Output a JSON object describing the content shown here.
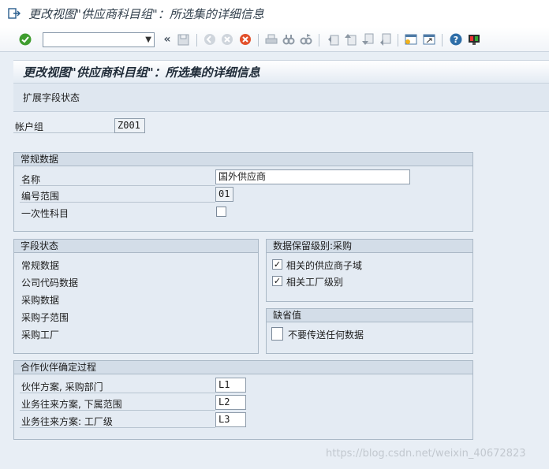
{
  "window": {
    "title": "更改视图\"供应商科目组\"：所选集的详细信息"
  },
  "toolbar": {
    "command_value": "",
    "icons": [
      "check-icon",
      "dropdown-icon",
      "back-double-icon",
      "save-icon",
      "back-icon",
      "exit-icon",
      "cancel-icon",
      "print-icon",
      "find-icon",
      "find-next-icon",
      "first-page-icon",
      "prev-page-icon",
      "next-page-icon",
      "last-page-icon",
      "new-session-icon",
      "shortcut-icon",
      "help-icon",
      "customize-icon"
    ]
  },
  "header": {
    "title": "更改视图\"供应商科目组\"：所选集的详细信息"
  },
  "subbar": {
    "expand_label": "扩展字段状态"
  },
  "account_group": {
    "label": "帐户组",
    "value": "Z001"
  },
  "general": {
    "title": "常规数据",
    "name_label": "名称",
    "name_value": "国外供应商",
    "range_label": "编号范围",
    "range_value": "01",
    "onetime_label": "一次性科目"
  },
  "field_status": {
    "title": "字段状态",
    "items": [
      "常规数据",
      "公司代码数据",
      "采购数据",
      "采购子范围",
      "采购工厂"
    ]
  },
  "retention": {
    "title": "数据保留级别:采购",
    "items": [
      {
        "label": "相关的供应商子域",
        "checked": true
      },
      {
        "label": "相关工厂级别",
        "checked": true
      }
    ]
  },
  "defaults": {
    "title": "缺省值",
    "item_label": "不要传送任何数据"
  },
  "partner": {
    "title": "合作伙伴确定过程",
    "rows": [
      {
        "label": "伙伴方案, 采购部门",
        "value": "L1"
      },
      {
        "label": "业务往来方案, 下属范围",
        "value": "L2"
      },
      {
        "label": "业务往来方案: 工厂级",
        "value": "L3"
      }
    ]
  },
  "watermark": "https://blog.csdn.net/weixin_40672823"
}
